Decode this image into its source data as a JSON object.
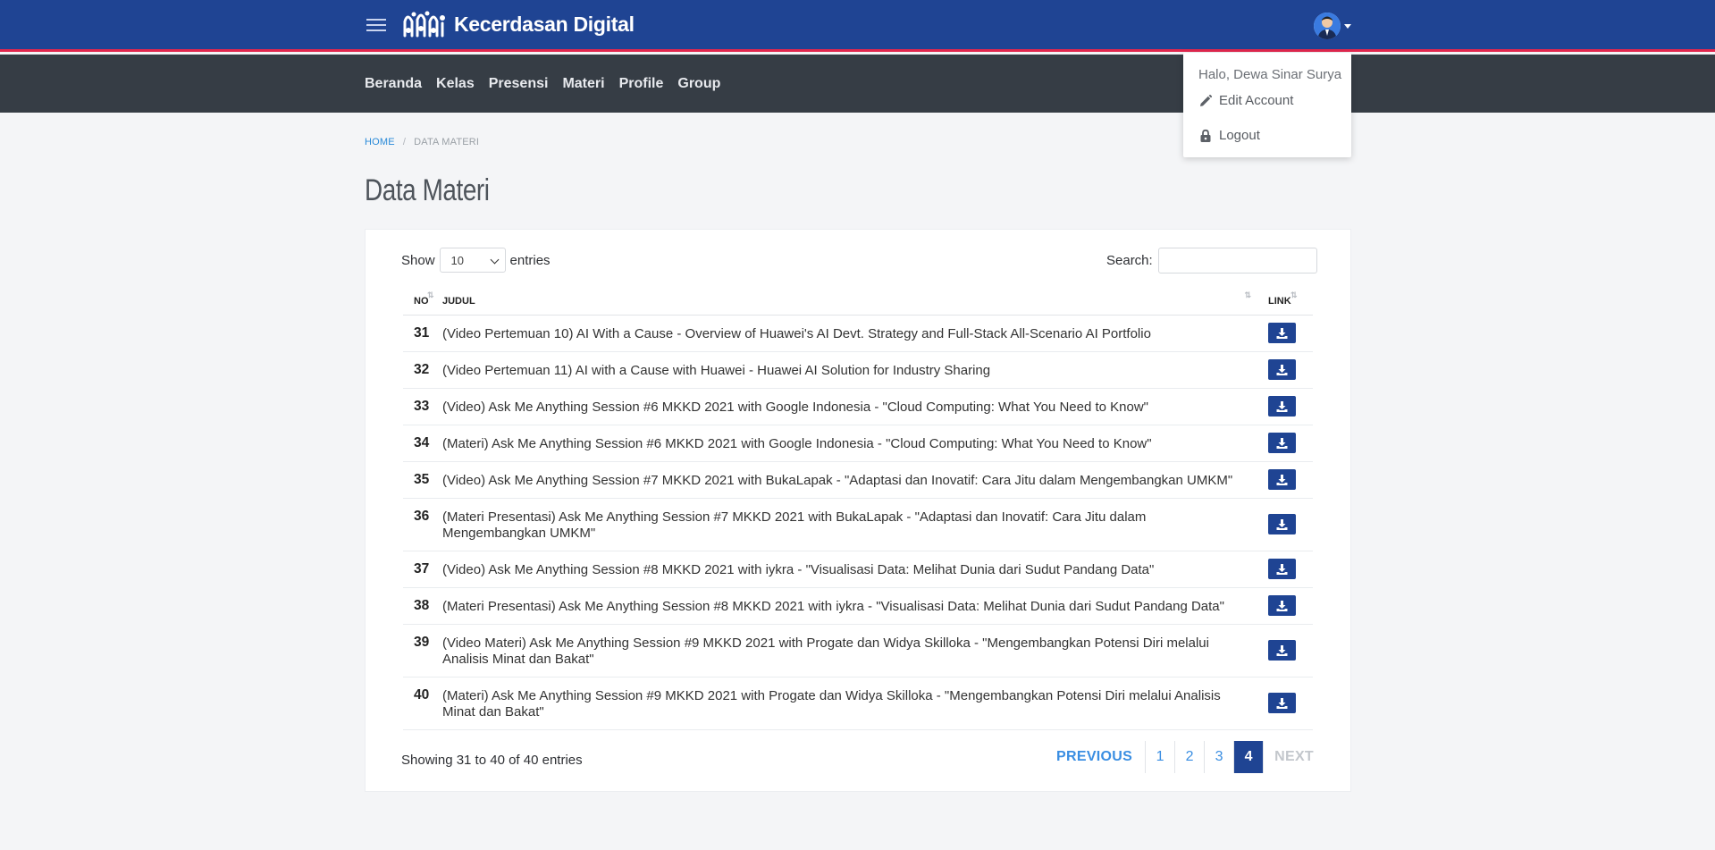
{
  "app": {
    "brand": "Kecerdasan Digital"
  },
  "nav": [
    "Beranda",
    "Kelas",
    "Presensi",
    "Materi",
    "Profile",
    "Group"
  ],
  "user_menu": {
    "greeting": "Halo, Dewa Sinar Surya",
    "edit_account": "Edit Account",
    "logout": "Logout"
  },
  "breadcrumb": {
    "home": "HOME",
    "sep": "/",
    "current": "DATA MATERI"
  },
  "page_title": "Data Materi",
  "table_controls": {
    "show_label": "Show",
    "entries_value": "10",
    "entries_label": "entries",
    "search_label": "Search:",
    "search_value": ""
  },
  "table": {
    "headers": {
      "no": "NO",
      "judul": "JUDUL",
      "link": "LINK"
    },
    "rows": [
      {
        "no": "31",
        "judul": "(Video Pertemuan 10) AI With a Cause - Overview of Huawei's AI Devt. Strategy and Full-Stack All-Scenario AI Portfolio"
      },
      {
        "no": "32",
        "judul": "(Video Pertemuan 11) AI with a Cause with Huawei - Huawei AI Solution for Industry Sharing"
      },
      {
        "no": "33",
        "judul": "(Video) Ask Me Anything Session #6 MKKD 2021 with Google Indonesia - \"Cloud Computing: What You Need to Know\""
      },
      {
        "no": "34",
        "judul": "(Materi) Ask Me Anything Session #6 MKKD 2021 with Google Indonesia - \"Cloud Computing: What You Need to Know\""
      },
      {
        "no": "35",
        "judul": "(Video) Ask Me Anything Session #7 MKKD 2021 with BukaLapak - \"Adaptasi dan Inovatif: Cara Jitu dalam Mengembangkan UMKM\""
      },
      {
        "no": "36",
        "judul": "(Materi Presentasi) Ask Me Anything Session #7 MKKD 2021 with BukaLapak - \"Adaptasi dan Inovatif: Cara Jitu dalam Mengembangkan UMKM\""
      },
      {
        "no": "37",
        "judul": "(Video) Ask Me Anything Session #8 MKKD 2021 with iykra - \"Visualisasi Data: Melihat Dunia dari Sudut Pandang Data\""
      },
      {
        "no": "38",
        "judul": "(Materi Presentasi) Ask Me Anything Session #8 MKKD 2021 with iykra - \"Visualisasi Data: Melihat Dunia dari Sudut Pandang Data\""
      },
      {
        "no": "39",
        "judul": "(Video Materi) Ask Me Anything Session #9 MKKD 2021 with Progate dan Widya Skilloka - \"Mengembangkan Potensi Diri melalui Analisis Minat dan Bakat\""
      },
      {
        "no": "40",
        "judul": "(Materi) Ask Me Anything Session #9 MKKD 2021 with Progate dan Widya Skilloka - \"Mengembangkan Potensi Diri melalui Analisis Minat dan Bakat\""
      }
    ]
  },
  "info": "Showing 31 to 40 of 40 entries",
  "pagination": {
    "previous": "PREVIOUS",
    "pages": [
      "1",
      "2",
      "3",
      "4"
    ],
    "active": "4",
    "next": "NEXT"
  },
  "colors": {
    "topbar": "#1f4493",
    "accent_line": "#e2264d",
    "navbar": "#363d45",
    "primary": "#1f4493",
    "link": "#3a8ee2"
  },
  "icons": [
    "menu-icon",
    "logo-icon",
    "avatar",
    "pencil-icon",
    "lock-icon",
    "download-icon"
  ]
}
